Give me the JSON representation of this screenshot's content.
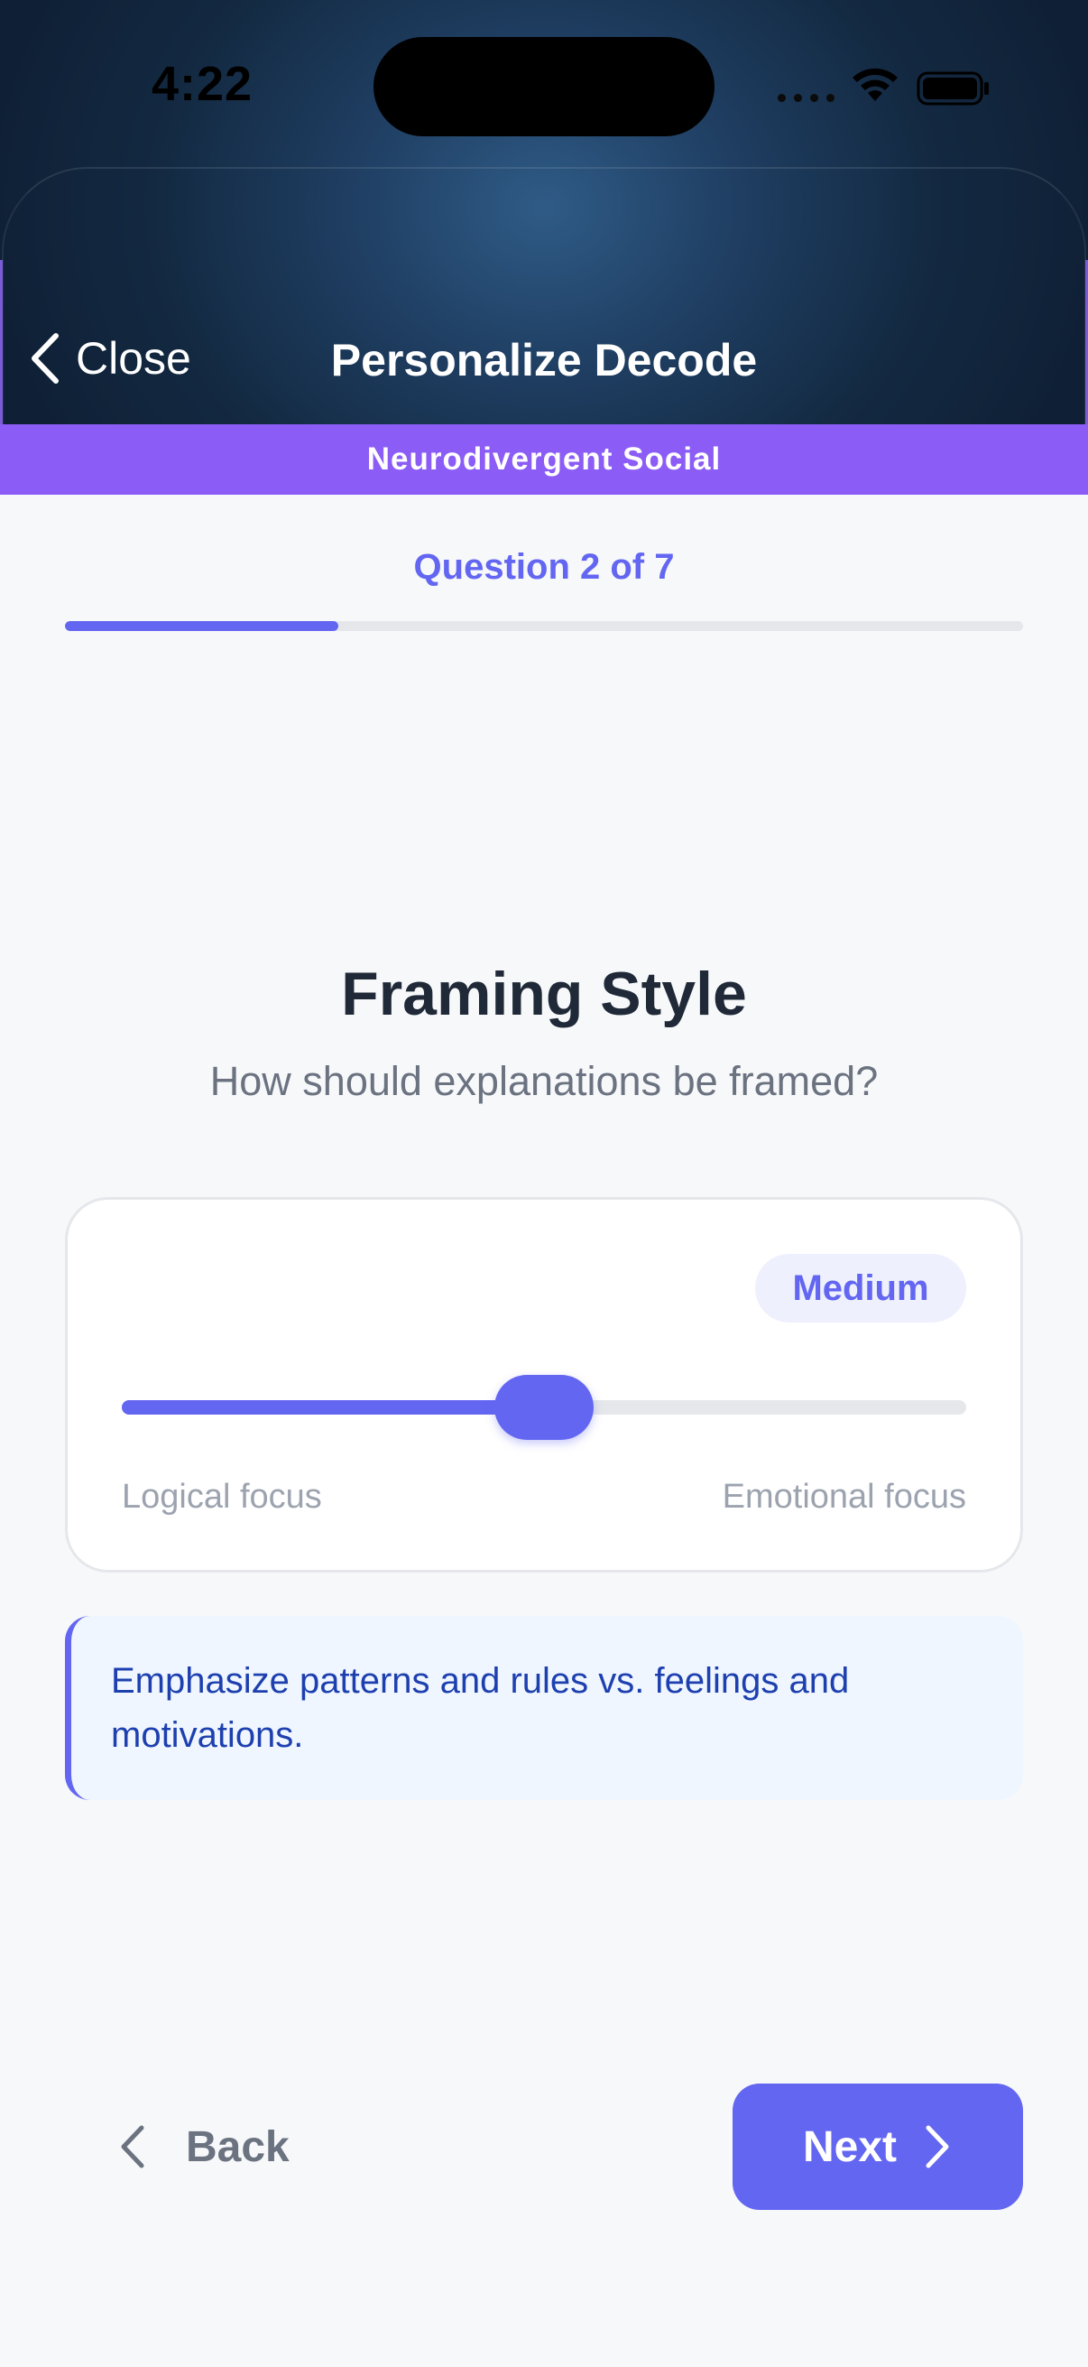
{
  "status_bar": {
    "time": "4:22",
    "signal_icon": "signal-dots-icon",
    "wifi_icon": "wifi-icon",
    "battery_icon": "battery-icon"
  },
  "nav": {
    "close_label": "Close",
    "close_icon": "chevron-left-icon",
    "title": "Personalize Decode"
  },
  "mode_banner": "Neurodivergent Social",
  "progress": {
    "label": "Question 2 of 7",
    "current": 2,
    "total": 7
  },
  "question": {
    "title": "Framing Style",
    "subtitle": "How should explanations be framed?"
  },
  "slider": {
    "level_label": "Medium",
    "value_fraction": 0.5,
    "min_label": "Logical focus",
    "max_label": "Emotional focus"
  },
  "hint": {
    "text": "Emphasize patterns and rules vs. feelings and motivations."
  },
  "footer": {
    "back_label": "Back",
    "next_label": "Next"
  },
  "colors": {
    "accent": "#6366f1",
    "banner": "#8b5cf6",
    "hint_background": "#eff6ff",
    "hint_text": "#1e40af",
    "header_dark": "#132941"
  }
}
